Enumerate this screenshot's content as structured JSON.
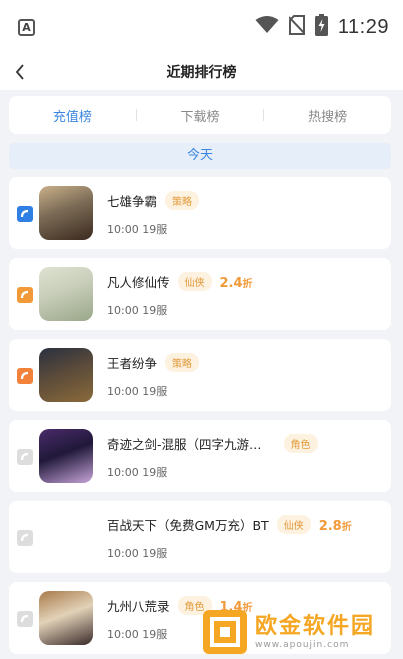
{
  "status_bar": {
    "app_icon_letter": "A",
    "time": "11:29"
  },
  "nav": {
    "title": "近期排行榜"
  },
  "tabs": [
    {
      "label": "充值榜",
      "active": true
    },
    {
      "label": "下载榜",
      "active": false
    },
    {
      "label": "热搜榜",
      "active": false
    }
  ],
  "date_label": "今天",
  "games": [
    {
      "name": "七雄争霸",
      "tag": "策略",
      "discount": "",
      "discount_unit": "",
      "time": "10:00 19服",
      "rank_color": "#2f7fe4",
      "icon_palette": [
        "#c9b089",
        "#3b2a1e",
        "#7a6a55"
      ]
    },
    {
      "name": "凡人修仙传",
      "tag": "仙侠",
      "discount": "2.4",
      "discount_unit": "折",
      "time": "10:00 19服",
      "rank_color": "#f29a3a",
      "icon_palette": [
        "#dfe3d2",
        "#9aa78a",
        "#c7cdb8"
      ]
    },
    {
      "name": "王者纷争",
      "tag": "策略",
      "discount": "",
      "discount_unit": "",
      "time": "10:00 19服",
      "rank_color": "#f2813a",
      "icon_palette": [
        "#2a3040",
        "#8a6a3a",
        "#5a4a3a"
      ]
    },
    {
      "name": "奇迹之剑-混服（四字九游…",
      "tag": "角色",
      "discount": "",
      "discount_unit": "",
      "time": "10:00 19服",
      "rank_color": "#dddddd",
      "icon_palette": [
        "#4a2c6a",
        "#c7a5d8",
        "#20183a"
      ]
    },
    {
      "name": "百战天下（免费GM万充）BT",
      "tag": "仙侠",
      "discount": "2.8",
      "discount_unit": "折",
      "time": "10:00 19服",
      "rank_color": "#dddddd",
      "icon_palette": []
    },
    {
      "name": "九州八荒录",
      "tag": "角色",
      "discount": "1.4",
      "discount_unit": "折",
      "time": "10:00 19服",
      "rank_color": "#dddddd",
      "icon_palette": [
        "#a87a4a",
        "#3a2a2a",
        "#e2d2b8"
      ]
    }
  ],
  "watermark": {
    "main_text": "欧金软件园",
    "url_text": "www.apoujin.com"
  }
}
